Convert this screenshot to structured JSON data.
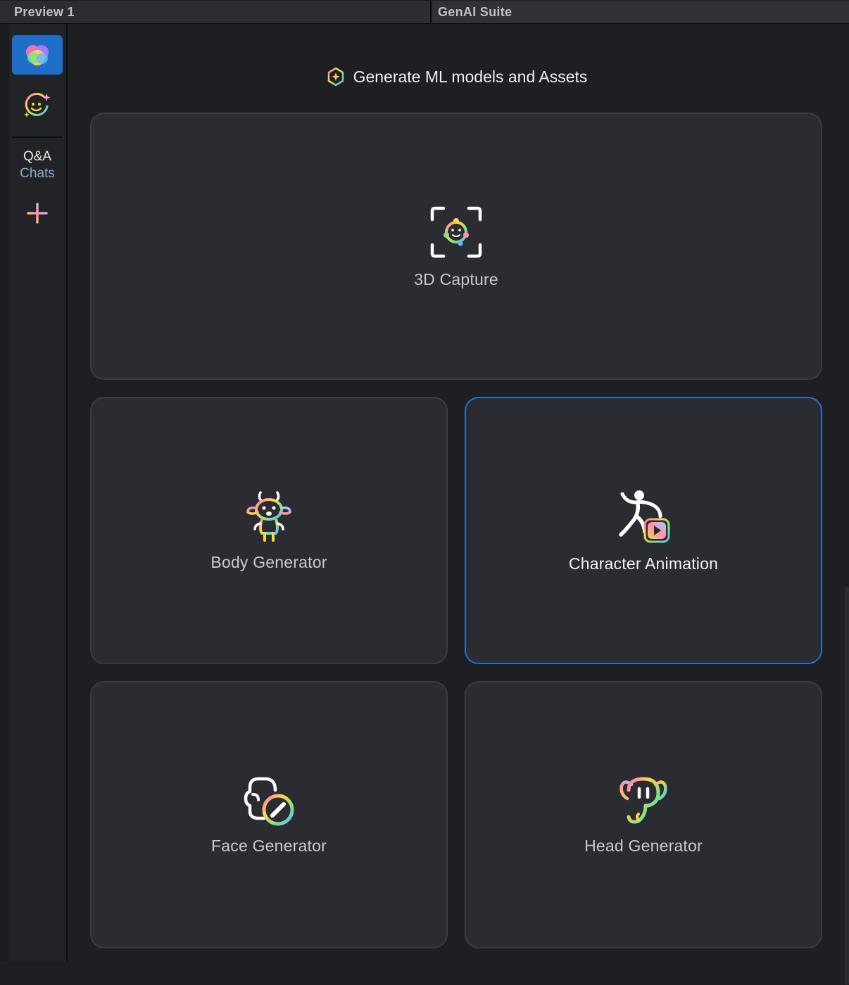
{
  "tabs": [
    {
      "label": "Preview 1"
    },
    {
      "label": "GenAI Suite"
    }
  ],
  "sidebar": {
    "items": [
      {
        "icon": "genai-palette-icon",
        "active": true
      },
      {
        "icon": "sparkle-face-icon",
        "active": false
      }
    ],
    "section_label_line1": "Q&A",
    "section_label_line2": "Chats",
    "add_icon": "plus-icon"
  },
  "main": {
    "heading": "Generate ML models and Assets",
    "heading_icon": "ml-sparkle-icon",
    "cards": [
      {
        "label": "3D Capture",
        "icon": "capture-3d-icon",
        "selected": false
      },
      {
        "label": "Body Generator",
        "icon": "body-creature-icon",
        "selected": false
      },
      {
        "label": "Character Animation",
        "icon": "running-figure-play-icon",
        "selected": true
      },
      {
        "label": "Face Generator",
        "icon": "face-edit-icon",
        "selected": false
      },
      {
        "label": "Head Generator",
        "icon": "head-creature-icon",
        "selected": false
      }
    ]
  },
  "colors": {
    "accent": "#1f6fc8",
    "selected_border": "#1e73d6",
    "card_bg": "#2a2c31",
    "background": "#1e1f22"
  }
}
